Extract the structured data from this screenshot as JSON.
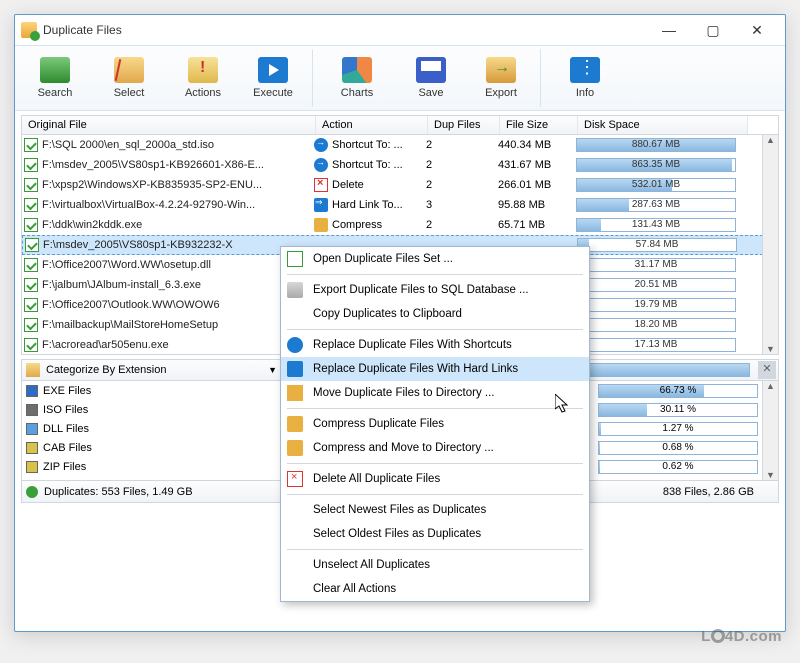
{
  "window": {
    "title": "Duplicate Files"
  },
  "toolbar": [
    {
      "id": "search",
      "label": "Search"
    },
    {
      "id": "select",
      "label": "Select"
    },
    {
      "id": "actions",
      "label": "Actions"
    },
    {
      "id": "execute",
      "label": "Execute"
    },
    {
      "id": "charts",
      "label": "Charts"
    },
    {
      "id": "save",
      "label": "Save"
    },
    {
      "id": "export",
      "label": "Export"
    },
    {
      "id": "info",
      "label": "Info"
    }
  ],
  "columns": {
    "file": "Original File",
    "action": "Action",
    "dup": "Dup Files",
    "size": "File Size",
    "space": "Disk Space"
  },
  "files": [
    {
      "name": "F:\\SQL 2000\\en_sql_2000a_std.iso",
      "action": "Shortcut To: ...",
      "ai": "short",
      "dup": "2",
      "size": "440.34 MB",
      "space": "880.67 MB",
      "pct": 100
    },
    {
      "name": "F:\\msdev_2005\\VS80sp1-KB926601-X86-E...",
      "action": "Shortcut To: ...",
      "ai": "short",
      "dup": "2",
      "size": "431.67 MB",
      "space": "863.35 MB",
      "pct": 98
    },
    {
      "name": "F:\\xpsp2\\WindowsXP-KB835935-SP2-ENU...",
      "action": "Delete",
      "ai": "del",
      "dup": "2",
      "size": "266.01 MB",
      "space": "532.01 MB",
      "pct": 60
    },
    {
      "name": "F:\\virtualbox\\VirtualBox-4.2.24-92790-Win...",
      "action": "Hard Link To...",
      "ai": "hard",
      "dup": "3",
      "size": "95.88 MB",
      "space": "287.63 MB",
      "pct": 33
    },
    {
      "name": "F:\\ddk\\win2kddk.exe",
      "action": "Compress",
      "ai": "comp",
      "dup": "2",
      "size": "65.71 MB",
      "space": "131.43 MB",
      "pct": 15
    },
    {
      "name": "F:\\msdev_2005\\VS80sp1-KB932232-X",
      "action": "",
      "ai": "",
      "dup": "",
      "size": "",
      "space": "57.84 MB",
      "pct": 7,
      "sel": true
    },
    {
      "name": "F:\\Office2007\\Word.WW\\osetup.dll",
      "action": "",
      "ai": "",
      "dup": "",
      "size": "",
      "space": "31.17 MB",
      "pct": 4
    },
    {
      "name": "F:\\jalbum\\JAlbum-install_6.3.exe",
      "action": "",
      "ai": "",
      "dup": "",
      "size": "",
      "space": "20.51 MB",
      "pct": 2.5
    },
    {
      "name": "F:\\Office2007\\Outlook.WW\\OWOW6",
      "action": "",
      "ai": "",
      "dup": "",
      "size": "",
      "space": "19.79 MB",
      "pct": 2.3
    },
    {
      "name": "F:\\mailbackup\\MailStoreHomeSetup",
      "action": "",
      "ai": "",
      "dup": "",
      "size": "",
      "space": "18.20 MB",
      "pct": 2.1
    },
    {
      "name": "F:\\acroread\\ar505enu.exe",
      "action": "",
      "ai": "",
      "dup": "",
      "size": "",
      "space": "17.13 MB",
      "pct": 2
    }
  ],
  "categorize": {
    "label": "Categorize By Extension",
    "progress": "100%"
  },
  "categories": [
    {
      "name": "EXE Files",
      "pct": 66.73,
      "color": "#2e6ac7"
    },
    {
      "name": "ISO Files",
      "pct": 30.11,
      "color": "#6d6d6d"
    },
    {
      "name": "DLL Files",
      "pct": 1.27,
      "color": "#5aa0e0"
    },
    {
      "name": "CAB Files",
      "pct": 0.68,
      "color": "#d8c24a"
    },
    {
      "name": "ZIP Files",
      "pct": 0.62,
      "color": "#d8c24a"
    }
  ],
  "status": {
    "left": "Duplicates: 553 Files, 1.49 GB",
    "right": "838 Files, 2.86 GB"
  },
  "contextmenu": [
    {
      "label": "Open Duplicate Files Set ...",
      "icon": "open"
    },
    {
      "sep": true
    },
    {
      "label": "Export Duplicate Files to SQL Database ...",
      "icon": "db"
    },
    {
      "label": "Copy Duplicates to Clipboard",
      "icon": ""
    },
    {
      "sep": true
    },
    {
      "label": "Replace Duplicate Files With Shortcuts",
      "icon": "short"
    },
    {
      "label": "Replace Duplicate Files With Hard Links",
      "icon": "hard",
      "hover": true
    },
    {
      "label": "Move Duplicate Files to Directory ...",
      "icon": "move"
    },
    {
      "sep": true
    },
    {
      "label": "Compress Duplicate Files",
      "icon": "comp"
    },
    {
      "label": "Compress and Move to Directory ...",
      "icon": "comp"
    },
    {
      "sep": true
    },
    {
      "label": "Delete All Duplicate Files",
      "icon": "del"
    },
    {
      "sep": true
    },
    {
      "label": "Select Newest Files as Duplicates",
      "icon": ""
    },
    {
      "label": "Select Oldest Files as Duplicates",
      "icon": ""
    },
    {
      "sep": true
    },
    {
      "label": "Unselect All Duplicates",
      "icon": ""
    },
    {
      "label": "Clear All Actions",
      "icon": ""
    }
  ],
  "watermark": "LO4D.com"
}
